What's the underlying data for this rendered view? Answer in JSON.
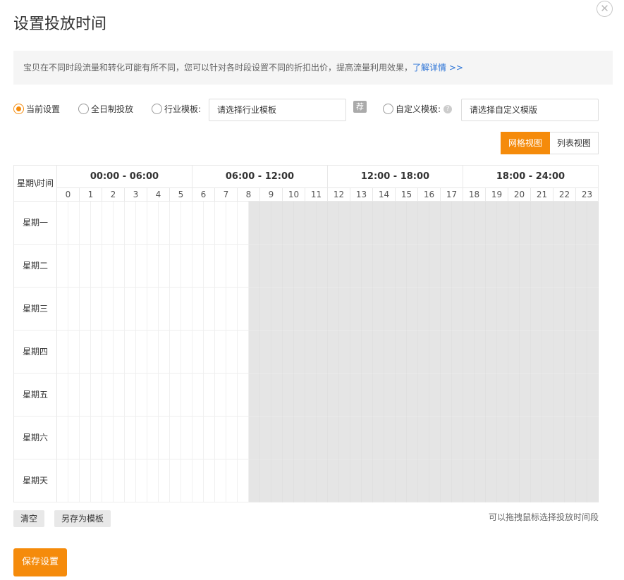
{
  "dialog": {
    "title": "设置投放时间",
    "close_symbol": "✕",
    "notice_text": "宝贝在不同时段流量和转化可能有所不同，您可以针对各时段设置不同的折扣出价，提高流量利用效果，",
    "notice_link": "了解详情 >>"
  },
  "options": {
    "current": "当前设置",
    "all_day": "全日制投放",
    "industry_label": "行业模板:",
    "industry_placeholder": "请选择行业模板",
    "recommend_badge": "荐",
    "custom_label": "自定义模板:",
    "custom_placeholder": "请选择自定义模版",
    "help_symbol": "?",
    "selected": "current"
  },
  "views": {
    "grid": "网格视图",
    "list": "列表视图",
    "active": "grid"
  },
  "grid": {
    "corner": "星期\\时间",
    "segments": [
      "00:00 - 06:00",
      "06:00 - 12:00",
      "12:00 - 18:00",
      "18:00 - 24:00"
    ],
    "hours": [
      "0",
      "1",
      "2",
      "3",
      "4",
      "5",
      "6",
      "7",
      "8",
      "9",
      "10",
      "11",
      "12",
      "13",
      "14",
      "15",
      "16",
      "17",
      "18",
      "19",
      "20",
      "21",
      "22",
      "23"
    ],
    "days": [
      "星期一",
      "星期二",
      "星期三",
      "星期四",
      "星期五",
      "星期六",
      "星期天"
    ],
    "selected_from_half_hour": 17,
    "half_hours_per_day": 48
  },
  "footer": {
    "clear": "清空",
    "save_template": "另存为模板",
    "hint": "可以拖拽鼠标选择投放时间段",
    "save": "保存设置"
  },
  "colors": {
    "accent": "#f58b0b",
    "link": "#2b73d6",
    "selected_slot": "#e5e5e5"
  }
}
